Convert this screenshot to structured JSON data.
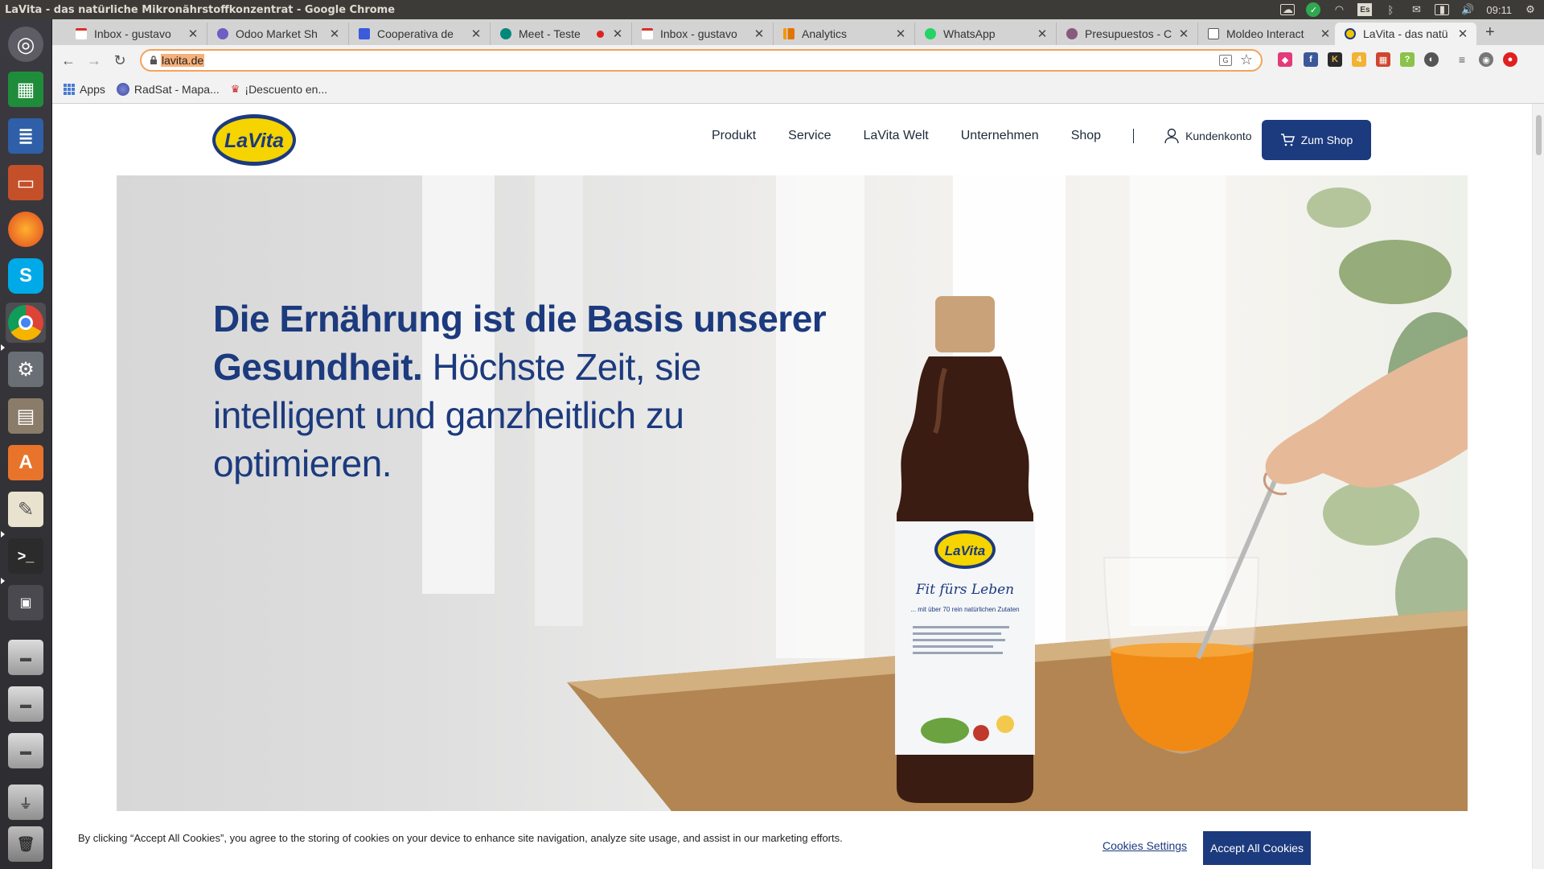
{
  "window": {
    "title": "LaVita - das natürliche Mikronährstoffkonzentrat - Google Chrome"
  },
  "system_tray": {
    "language": "Es",
    "clock": "09:11"
  },
  "tabs": [
    {
      "title": "Inbox - gustavo",
      "favicon": "gmail-icon",
      "color": "#d93025"
    },
    {
      "title": "Odoo Market Sh",
      "favicon": "odoo-icon",
      "color": "#6f5cc4"
    },
    {
      "title": "Cooperativa de",
      "favicon": "calendar-icon",
      "color": "#3b5bdb"
    },
    {
      "title": "Meet - Teste",
      "favicon": "meet-icon",
      "color": "#00897b"
    },
    {
      "title": "Inbox - gustavo",
      "favicon": "gmail-icon",
      "color": "#d93025"
    },
    {
      "title": "Analytics",
      "favicon": "analytics-icon",
      "color": "#f29900"
    },
    {
      "title": "WhatsApp",
      "favicon": "whatsapp-icon",
      "color": "#25d366"
    },
    {
      "title": "Presupuestos - C",
      "favicon": "odoo-icon",
      "color": "#875a7b"
    },
    {
      "title": "Moldeo Interact",
      "favicon": "moldeo-icon",
      "color": "#555555"
    },
    {
      "title": "LaVita - das natü",
      "favicon": "lavita-icon",
      "color": "#f2c500"
    }
  ],
  "address_bar": {
    "url": "lavita.de"
  },
  "bookmarks": [
    {
      "label": "Apps"
    },
    {
      "label": "RadSat - Mapa..."
    },
    {
      "label": "¡Descuento en..."
    }
  ],
  "site": {
    "logo_text": "LaVita",
    "nav": [
      "Produkt",
      "Service",
      "LaVita Welt",
      "Unternehmen",
      "Shop"
    ],
    "account_label": "Kundenkonto",
    "shop_button": "Zum Shop",
    "brand_color": "#1c3a7e"
  },
  "hero": {
    "headline_bold": "Die Ernährung ist die Basis unserer Gesundheit.",
    "headline_regular": "Höchste Zeit, sie intelligent und ganzheitlich zu optimieren.",
    "bottle_label_logo": "LaVita",
    "bottle_label_tagline": "Fit fürs Leben",
    "bottle_label_subline": "... mit über 70 rein natürlichen Zutaten"
  },
  "cookie_banner": {
    "text": "By clicking “Accept All Cookies”, you agree to the storing of cookies on your device to enhance site navigation, analyze site usage, and assist in our marketing efforts.",
    "settings_label": "Cookies Settings",
    "accept_label": "Accept All Cookies"
  }
}
